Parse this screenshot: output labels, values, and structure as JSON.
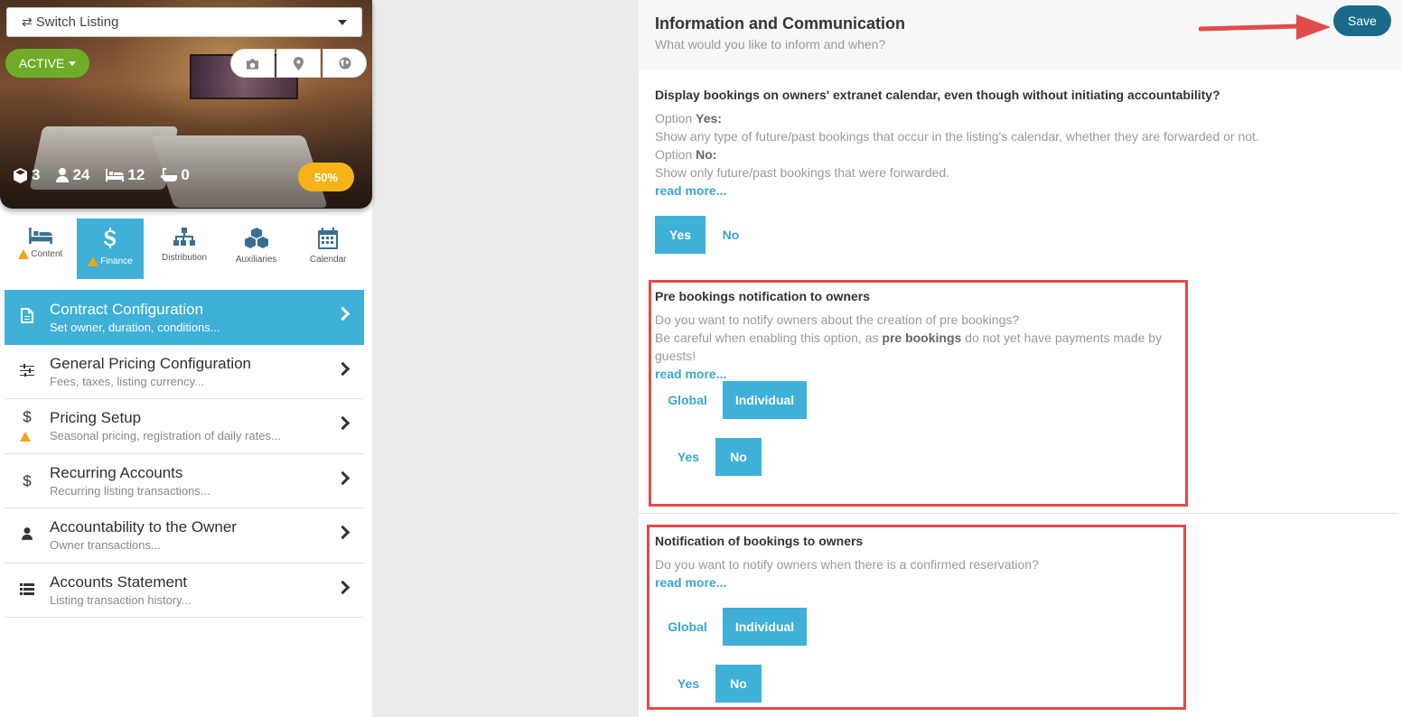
{
  "listing": {
    "switch_label": "Switch Listing",
    "status": "ACTIVE",
    "stats": {
      "rooms": "3",
      "guests": "24",
      "beds": "12",
      "baths": "0"
    },
    "completion": "50%"
  },
  "tabs": [
    {
      "label": "Content",
      "warn": true
    },
    {
      "label": "Finance",
      "warn": true
    },
    {
      "label": "Distribution",
      "warn": false
    },
    {
      "label": "Auxiliaries",
      "warn": false
    },
    {
      "label": "Calendar",
      "warn": false
    }
  ],
  "menu": [
    {
      "title": "Contract Configuration",
      "sub": "Set owner, duration, conditions..."
    },
    {
      "title": "General Pricing Configuration",
      "sub": "Fees, taxes, listing currency..."
    },
    {
      "title": "Pricing Setup",
      "sub": "Seasonal pricing, registration of daily rates..."
    },
    {
      "title": "Recurring Accounts",
      "sub": "Recurring listing transactions..."
    },
    {
      "title": "Accountability to the Owner",
      "sub": "Owner transactions..."
    },
    {
      "title": "Accounts Statement",
      "sub": "Listing transaction history..."
    }
  ],
  "header": {
    "title": "Information and Communication",
    "subtitle": "What would you like to inform and when?",
    "save": "Save"
  },
  "section1": {
    "question": "Display bookings on owners' extranet calendar, even though without initiating accountability?",
    "opt_yes_prefix": "Option ",
    "opt_yes_word": "Yes:",
    "opt_yes_desc": "Show any type of future/past bookings that occur in the listing's calendar, whether they are forwarded or not.",
    "opt_no_prefix": "Option ",
    "opt_no_word": "No:",
    "opt_no_desc": "Show only future/past bookings that were forwarded.",
    "read_more": "read more...",
    "yes": "Yes",
    "no": "No"
  },
  "section2": {
    "question": "Pre bookings notification to owners",
    "line1": "Do you want to notify owners about the creation of pre bookings?",
    "line2_a": "Be careful when enabling this option, as ",
    "line2_b": "pre bookings",
    "line2_c": " do not yet have payments made by guests!",
    "read_more": "read more...",
    "global": "Global",
    "individual": "Individual",
    "yes": "Yes",
    "no": "No"
  },
  "section3": {
    "question": "Notification of bookings to owners",
    "line1": "Do you want to notify owners when there is a confirmed reservation?",
    "read_more": "read more...",
    "global": "Global",
    "individual": "Individual",
    "yes": "Yes",
    "no": "No"
  },
  "colors": {
    "accent": "#3fb0d8",
    "save": "#1a6a8a",
    "status": "#6fad28",
    "highlight": "#e24b4b",
    "badge": "#f6b219"
  }
}
